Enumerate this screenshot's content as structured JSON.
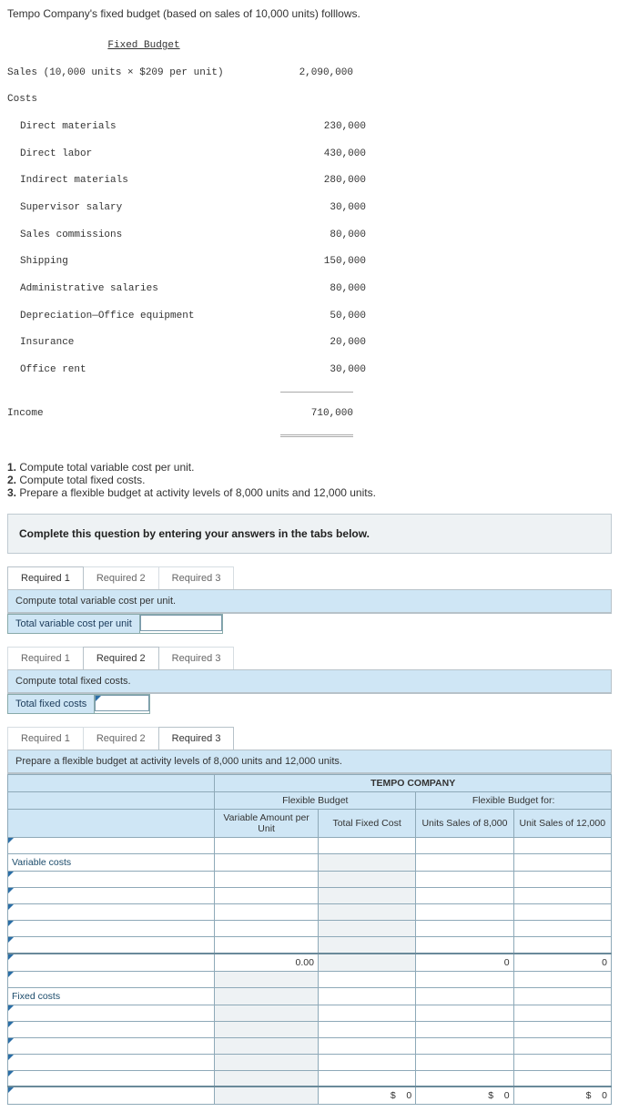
{
  "intro": "Tempo Company's fixed budget (based on sales of 10,000 units) folllows.",
  "budget": {
    "header": "Fixed Budget",
    "sales_label": "Sales (10,000 units × $209 per unit)",
    "sales_value": "2,090,000",
    "costs_label": "Costs",
    "lines": [
      {
        "label": "Direct materials",
        "value": "230,000"
      },
      {
        "label": "Direct labor",
        "value": "430,000"
      },
      {
        "label": "Indirect materials",
        "value": "280,000"
      },
      {
        "label": "Supervisor salary",
        "value": "30,000"
      },
      {
        "label": "Sales commissions",
        "value": "80,000"
      },
      {
        "label": "Shipping",
        "value": "150,000"
      },
      {
        "label": "Administrative salaries",
        "value": "80,000"
      },
      {
        "label": "Depreciation—Office equipment",
        "value": "50,000"
      },
      {
        "label": "Insurance",
        "value": "20,000"
      },
      {
        "label": "Office rent",
        "value": "30,000"
      }
    ],
    "income_label": "Income",
    "income_value": "710,000"
  },
  "questions": {
    "q1": "Compute total variable cost per unit.",
    "q2": "Compute total fixed costs.",
    "q3": "Prepare a flexible budget at activity levels of 8,000 units and 12,000 units."
  },
  "answer_prompt": "Complete this question by entering your answers in the tabs below.",
  "tabs": {
    "r1": "Required 1",
    "r2": "Required 2",
    "r3": "Required 3"
  },
  "panel1": {
    "instr": "Compute total variable cost per unit.",
    "field_label": "Total variable cost per unit"
  },
  "panel2": {
    "instr": "Compute total fixed costs.",
    "field_label": "Total fixed costs"
  },
  "panel3": {
    "instr": "Prepare a flexible budget at activity levels of 8,000 units and 12,000 units.",
    "company": "TEMPO COMPANY",
    "fb": "Flexible Budget",
    "fbfor": "Flexible Budget for:",
    "col_var": "Variable Amount per Unit",
    "col_fixed": "Total Fixed Cost",
    "col_8000": "Units Sales of 8,000",
    "col_12000": "Unit Sales of 12,000",
    "var_label": "Variable costs",
    "fixed_label": "Fixed costs",
    "zero_dec": "0.00",
    "zero": "0",
    "currency": "$"
  }
}
